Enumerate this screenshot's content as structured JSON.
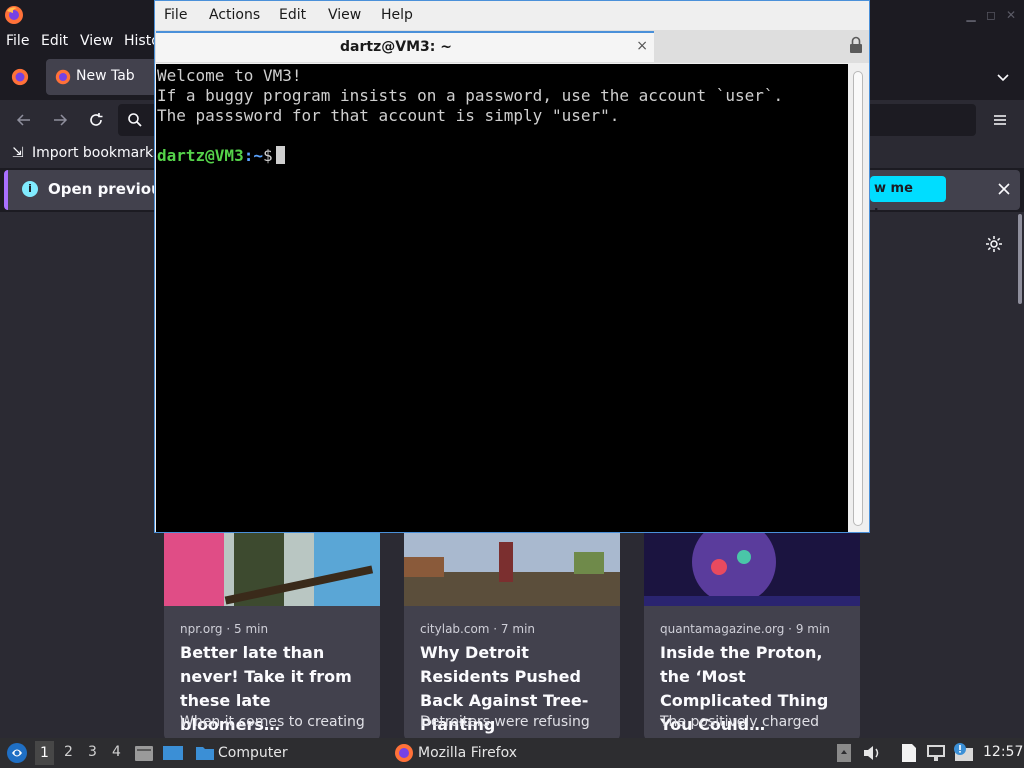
{
  "firefox": {
    "menu": [
      "File",
      "Edit",
      "View",
      "Histo"
    ],
    "tab_label": "New Tab",
    "bookmarks_import": "Import bookmarks",
    "notification_text": "Open previous",
    "notification_button": "w me how",
    "cards": [
      {
        "source": "npr.org · 5 min",
        "title": "Better late than never! Take it from these late bloomers…",
        "desc": "When it comes to creating"
      },
      {
        "source": "citylab.com · 7 min",
        "title": "Why Detroit Residents Pushed Back Against Tree-Planting",
        "desc": "Detroiters were refusing"
      },
      {
        "source": "quantamagazine.org · 9 min",
        "title": "Inside the Proton, the ‘Most Complicated Thing You Could…",
        "desc": "The positively charged"
      }
    ]
  },
  "terminal": {
    "menu": [
      "File",
      "Actions",
      "Edit",
      "View",
      "Help"
    ],
    "tab_title": "dartz@VM3: ~",
    "close_glyph": "×",
    "lines": [
      "Welcome to VM3!",
      "If a buggy program insists on a password, use the account `user`.",
      "The passsword for that account is simply \"user\"."
    ],
    "prompt_user": "dartz@VM3",
    "prompt_path": ":~",
    "prompt_symbol": "$"
  },
  "taskbar": {
    "workspaces": [
      "1",
      "2",
      "3",
      "4"
    ],
    "tasks": [
      {
        "label": "Computer"
      },
      {
        "label": "Mozilla Firefox"
      }
    ],
    "clock": "12:57"
  },
  "colors": {
    "terminal_bg": "#000000",
    "prompt_user": "#55d24a",
    "prompt_path": "#5aa3ff",
    "accent_blue": "#4a90d9",
    "firefox_notification_button": "#00ddff"
  }
}
